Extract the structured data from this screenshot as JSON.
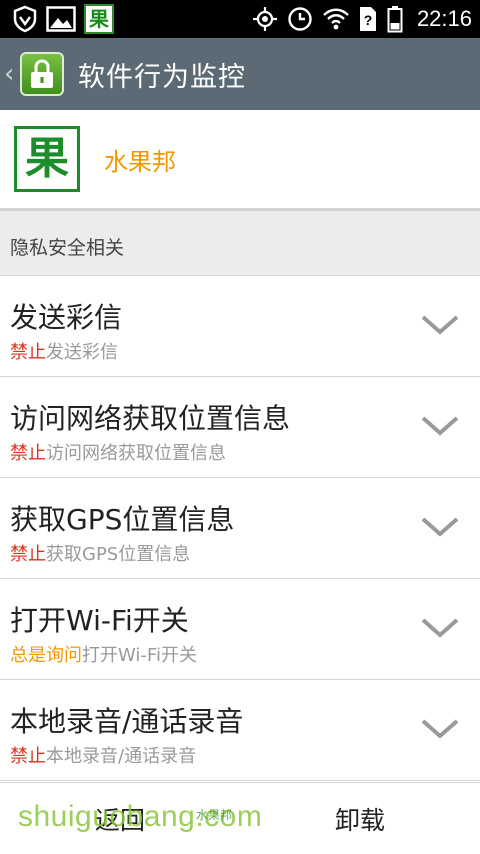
{
  "status_bar": {
    "time": "22:16",
    "fruit_icon_char": "果",
    "battery_mark": "?"
  },
  "title_bar": {
    "title": "软件行为监控"
  },
  "app": {
    "logo_char": "果",
    "name": "水果邦"
  },
  "section": {
    "title": "隐私安全相关"
  },
  "permissions": [
    {
      "title": "发送彩信",
      "status": "禁止",
      "description": "发送彩信"
    },
    {
      "title": "访问网络获取位置信息",
      "status": "禁止",
      "description": "访问网络获取位置信息"
    },
    {
      "title": "获取GPS位置信息",
      "status": "禁止",
      "description": "获取GPS位置信息"
    },
    {
      "title": "打开Wi-Fi开关",
      "status": "总是询问",
      "description": "打开Wi-Fi开关"
    },
    {
      "title": "本地录音/通话录音",
      "status": "禁止",
      "description": "本地录音/通话录音"
    }
  ],
  "bottom_bar": {
    "back_label": "返回",
    "uninstall_label": "卸载"
  },
  "watermark": {
    "text": "shuiguobang.com",
    "cn_text": "水果邦"
  },
  "colors": {
    "title_bar_bg": "#5b6a74",
    "deny_status": "#d9341e",
    "ask_status": "#f39800",
    "app_name": "#f39800"
  }
}
